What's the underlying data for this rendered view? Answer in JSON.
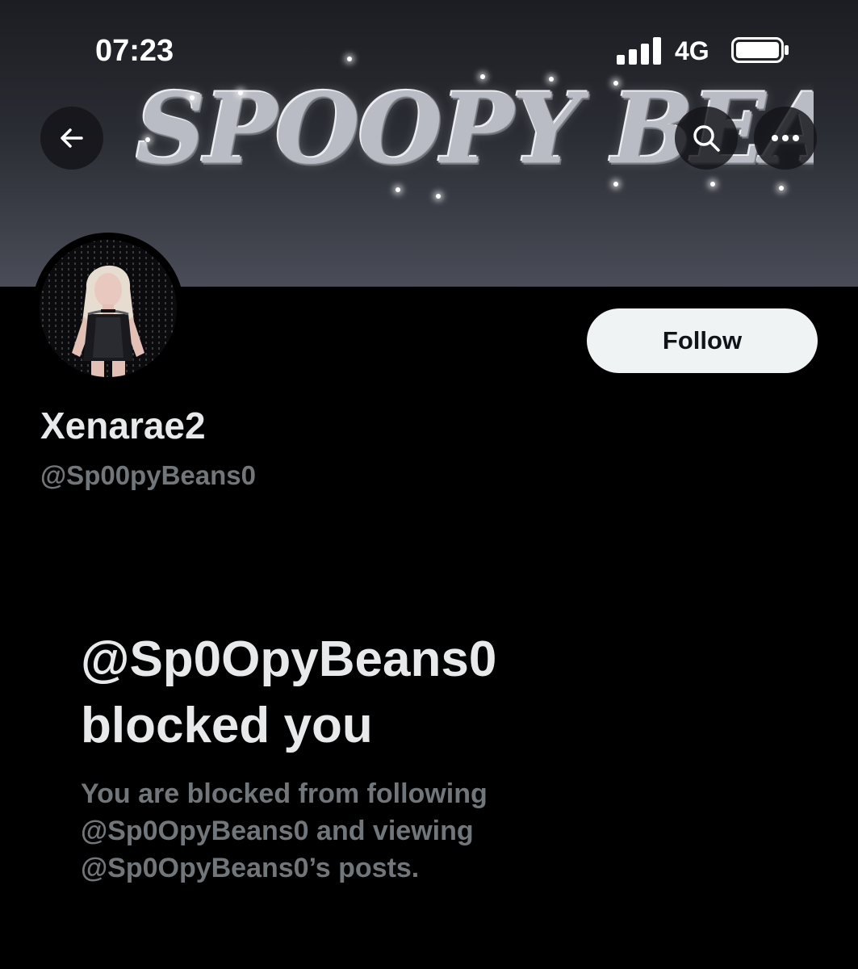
{
  "status_bar": {
    "time": "07:23",
    "network": "4G",
    "icons": [
      "signal-bars-icon",
      "battery-icon"
    ]
  },
  "header": {
    "banner_text": "SPOOPY BEANS",
    "buttons": [
      {
        "name": "back",
        "icon": "arrow-left-icon"
      },
      {
        "name": "search",
        "icon": "search-icon"
      },
      {
        "name": "more",
        "icon": "ellipsis-icon"
      }
    ]
  },
  "profile": {
    "display_name": "Xenarae2",
    "handle": "@Sp00pyBeans0",
    "follow_label": "Follow"
  },
  "blocked": {
    "title": "@Sp0OpyBeans0 blocked you",
    "description": "You are blocked from following @Sp0OpyBeans0 and viewing @Sp0OpyBeans0’s posts."
  },
  "colors": {
    "background": "#000000",
    "primary_text": "#e7e9ea",
    "secondary_text": "#71767b",
    "follow_button_bg": "#eff3f4"
  }
}
